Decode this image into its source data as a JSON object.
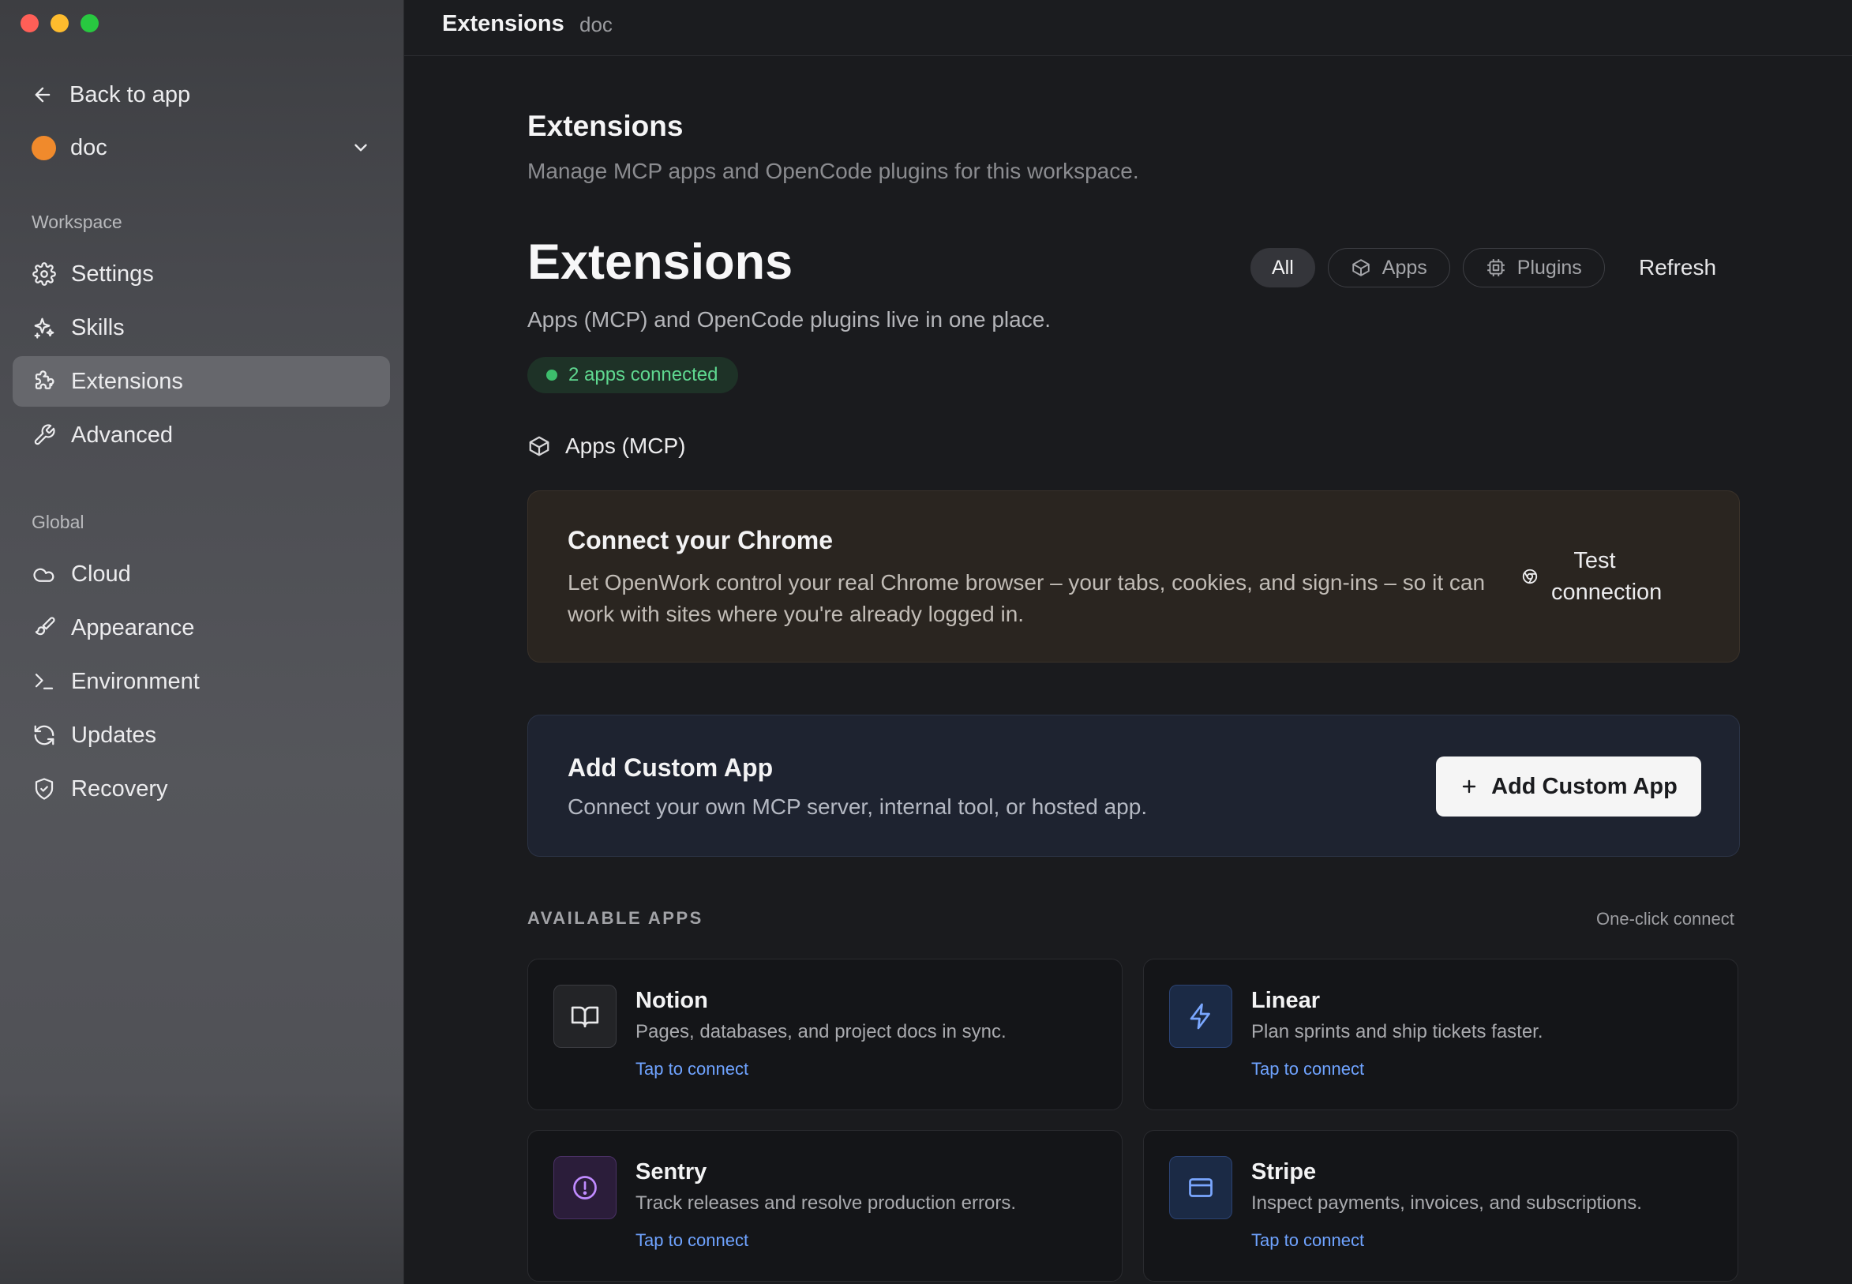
{
  "sidebar": {
    "back_label": "Back to app",
    "workspace_name": "doc",
    "workspace_section": "Workspace",
    "global_section": "Global",
    "items": {
      "settings": "Settings",
      "skills": "Skills",
      "extensions": "Extensions",
      "advanced": "Advanced",
      "cloud": "Cloud",
      "appearance": "Appearance",
      "environment": "Environment",
      "updates": "Updates",
      "recovery": "Recovery"
    },
    "active_item": "extensions"
  },
  "topbar": {
    "title": "Extensions",
    "workspace": "doc"
  },
  "page": {
    "title": "Extensions",
    "subtitle": "Manage MCP apps and OpenCode plugins for this workspace."
  },
  "extensions": {
    "title": "Extensions",
    "subtitle": "Apps (MCP) and OpenCode plugins live in one place.",
    "status": "2 apps connected",
    "filters": {
      "all": "All",
      "apps": "Apps",
      "plugins": "Plugins"
    },
    "active_filter": "All",
    "refresh": "Refresh"
  },
  "apps_section": {
    "title": "Apps (MCP)"
  },
  "chrome_card": {
    "title": "Connect your Chrome",
    "description": "Let OpenWork control your real Chrome browser – your tabs, cookies, and sign-ins – so it can work with sites where you're already logged in.",
    "button": "Test connection"
  },
  "custom_card": {
    "title": "Add Custom App",
    "description": "Connect your own MCP server, internal tool, or hosted app.",
    "button": "Add Custom App"
  },
  "available": {
    "label": "AVAILABLE APPS",
    "hint": "One-click connect",
    "apps": [
      {
        "name": "Notion",
        "description": "Pages, databases, and project docs in sync.",
        "action": "Tap to connect",
        "icon": "book-icon"
      },
      {
        "name": "Linear",
        "description": "Plan sprints and ship tickets faster.",
        "action": "Tap to connect",
        "icon": "bolt-icon"
      },
      {
        "name": "Sentry",
        "description": "Track releases and resolve production errors.",
        "action": "Tap to connect",
        "icon": "alert-circle-icon"
      },
      {
        "name": "Stripe",
        "description": "Inspect payments, invoices, and subscriptions.",
        "action": "Tap to connect",
        "icon": "credit-card-icon"
      }
    ]
  },
  "colors": {
    "accent_link": "#6fa3ff",
    "status_green": "#3dbd6c",
    "workspace_dot": "#f08a2c"
  }
}
